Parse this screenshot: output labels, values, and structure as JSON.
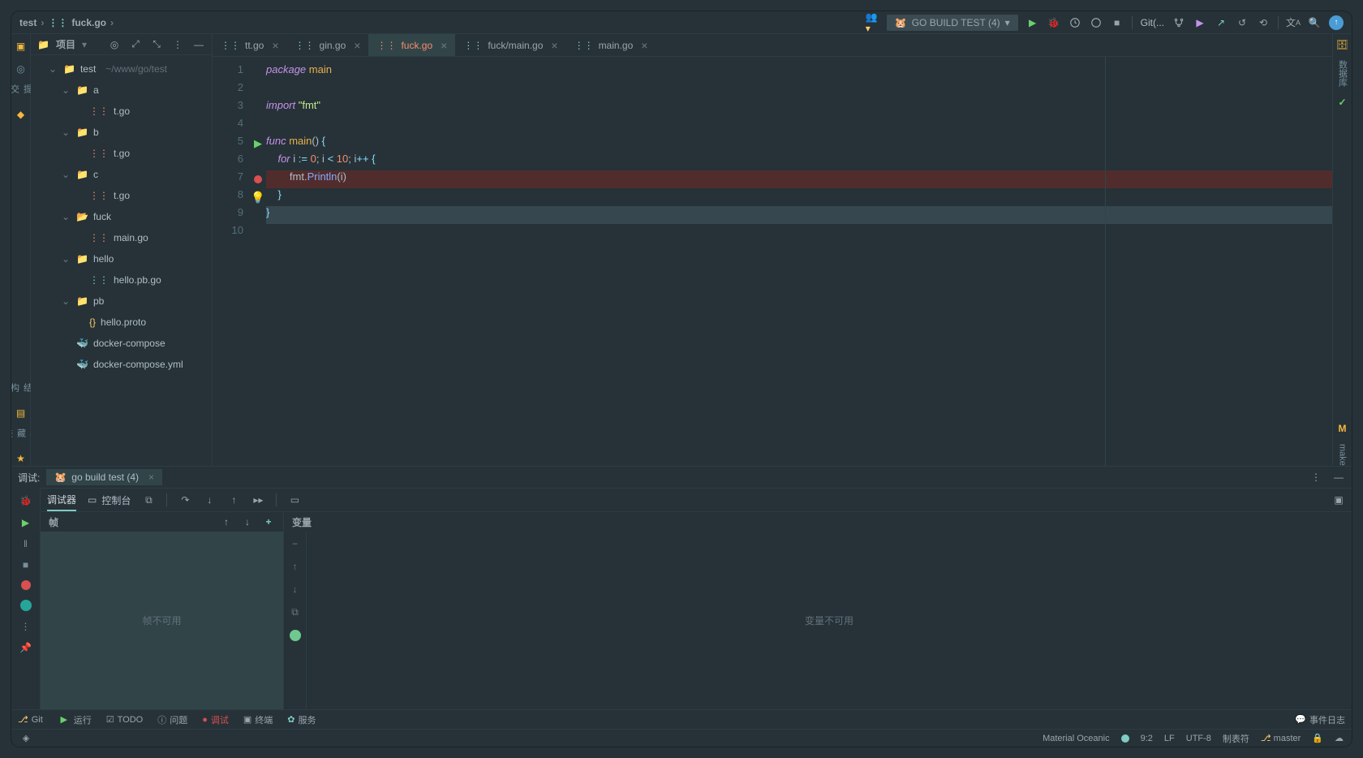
{
  "breadcrumb": {
    "root": "test",
    "file": "fuck.go",
    "rootIcon": "go",
    "fileIcon": "go"
  },
  "runConfig": {
    "label": "GO BUILD TEST (4)"
  },
  "gitLabel": "Git(...",
  "sidebar": {
    "title": "项目",
    "rootName": "test",
    "rootPath": "~/www/go/test",
    "tree": [
      {
        "indent": 1,
        "name": "test",
        "type": "folder",
        "chev": "down",
        "path": "~/www/go/test"
      },
      {
        "indent": 2,
        "name": "a",
        "type": "folder",
        "chev": "down"
      },
      {
        "indent": 3,
        "name": "t.go",
        "type": "go-sel"
      },
      {
        "indent": 2,
        "name": "b",
        "type": "folder",
        "chev": "down"
      },
      {
        "indent": 3,
        "name": "t.go",
        "type": "go-sel"
      },
      {
        "indent": 2,
        "name": "c",
        "type": "folder",
        "chev": "down"
      },
      {
        "indent": 3,
        "name": "t.go",
        "type": "go-sel"
      },
      {
        "indent": 2,
        "name": "fuck",
        "type": "folder-o",
        "chev": "down"
      },
      {
        "indent": 3,
        "name": "main.go",
        "type": "go-sel"
      },
      {
        "indent": 2,
        "name": "hello",
        "type": "folder",
        "chev": "down"
      },
      {
        "indent": 3,
        "name": "hello.pb.go",
        "type": "go"
      },
      {
        "indent": 2,
        "name": "pb",
        "type": "folder",
        "chev": "down"
      },
      {
        "indent": 3,
        "name": "hello.proto",
        "type": "proto"
      },
      {
        "indent": 2,
        "name": "docker-compose",
        "type": "docker"
      },
      {
        "indent": 2,
        "name": "docker-compose.yml",
        "type": "docker"
      }
    ]
  },
  "tabs": [
    {
      "label": "tt.go",
      "active": false
    },
    {
      "label": "gin.go",
      "active": false
    },
    {
      "label": "fuck.go",
      "active": true
    },
    {
      "label": "fuck/main.go",
      "active": false
    },
    {
      "label": "main.go",
      "active": false
    }
  ],
  "code": {
    "lines": [
      {
        "n": 1,
        "segments": [
          {
            "c": "k1",
            "t": "package "
          },
          {
            "c": "k2",
            "t": "main"
          }
        ]
      },
      {
        "n": 2,
        "segments": []
      },
      {
        "n": 3,
        "segments": [
          {
            "c": "k1",
            "t": "import "
          },
          {
            "c": "k5",
            "t": "\"fmt\""
          }
        ]
      },
      {
        "n": 4,
        "segments": []
      },
      {
        "n": 5,
        "mark": "run",
        "segments": [
          {
            "c": "k1",
            "t": "func "
          },
          {
            "c": "k2",
            "t": "main"
          },
          {
            "c": "k6",
            "t": "() "
          },
          {
            "c": "k7",
            "t": "{"
          }
        ]
      },
      {
        "n": 6,
        "segments": [
          {
            "c": "k6",
            "t": "    "
          },
          {
            "c": "k1",
            "t": "for "
          },
          {
            "c": "k6",
            "t": "i "
          },
          {
            "c": "k7",
            "t": ":="
          },
          {
            "c": "k6",
            "t": " "
          },
          {
            "c": "k3",
            "t": "0"
          },
          {
            "c": "k6",
            "t": "; i "
          },
          {
            "c": "k7",
            "t": "<"
          },
          {
            "c": "k6",
            "t": " "
          },
          {
            "c": "k3",
            "t": "10"
          },
          {
            "c": "k6",
            "t": "; i"
          },
          {
            "c": "k7",
            "t": "++"
          },
          {
            "c": "k6",
            "t": " "
          },
          {
            "c": "k7",
            "t": "{"
          }
        ]
      },
      {
        "n": 7,
        "mark": "bp",
        "hl": "highlight-line",
        "segments": [
          {
            "c": "k6",
            "t": "        fmt."
          },
          {
            "c": "k4",
            "t": "Println"
          },
          {
            "c": "k6",
            "t": "(i)"
          }
        ]
      },
      {
        "n": 8,
        "mark": "bulb",
        "segments": [
          {
            "c": "k6",
            "t": "    "
          },
          {
            "c": "k7",
            "t": "}"
          }
        ]
      },
      {
        "n": 9,
        "hl": "caret-line",
        "segments": [
          {
            "c": "k7",
            "t": "}"
          }
        ]
      },
      {
        "n": 10,
        "segments": []
      }
    ]
  },
  "debug": {
    "label": "调试:",
    "config": "go build test (4)",
    "tabs": {
      "debugger": "调试器",
      "console": "控制台"
    },
    "frames": {
      "title": "帧",
      "empty": "帧不可用"
    },
    "vars": {
      "title": "变量",
      "empty": "变量不可用"
    }
  },
  "bottom": {
    "git": "Git",
    "run": "运行",
    "todo": "TODO",
    "problems": "问题",
    "debug": "调试",
    "terminal": "终端",
    "services": "服务",
    "events": "事件日志"
  },
  "status": {
    "theme": "Material Oceanic",
    "pos": "9:2",
    "eol": "LF",
    "enc": "UTF-8",
    "tab": "制表符",
    "branch": "master"
  },
  "rightTool": {
    "db": "数据库",
    "make": "make"
  }
}
